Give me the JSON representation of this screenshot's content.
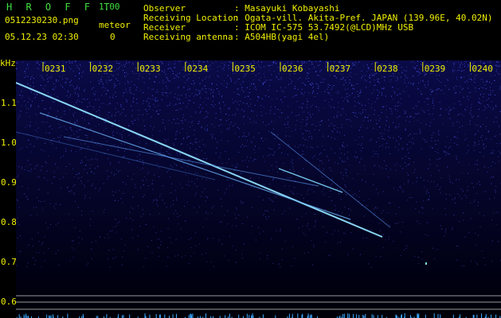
{
  "app": {
    "name": "H R O F F T",
    "version": "1.00",
    "filename": "0512230230.png",
    "datetime": "05.12.23 02:30",
    "meteor_label": "meteor",
    "meteor_count": "0"
  },
  "info": {
    "rows": [
      {
        "label": "Observer",
        "value": ": Masayuki Kobayashi"
      },
      {
        "label": "Receiving Location",
        "value": ": Ogata-vill. Akita-Pref. JAPAN (139.96E, 40.02N)"
      },
      {
        "label": "Receiver",
        "value": ": ICOM IC-575 53.7492(@LCD)MHz USB"
      },
      {
        "label": "Receiving antenna",
        "value": ": A504HB(yagi 4el)"
      }
    ]
  },
  "axis": {
    "unit": "kHz",
    "y_ticks": [
      "1.1",
      "1.0",
      "0.9",
      "0.8",
      "0.7",
      "0.6"
    ],
    "x_ticks": [
      "0231",
      "0232",
      "0233",
      "0234",
      "0235",
      "0236",
      "0237",
      "0238",
      "0239",
      "0240"
    ]
  },
  "colors": {
    "background": "#000000",
    "header_green": "#3fe03f",
    "header_yellow": "#f0f000",
    "noise_blue": "#2a2ab0",
    "trace_cyan": "#7fd8ff"
  }
}
